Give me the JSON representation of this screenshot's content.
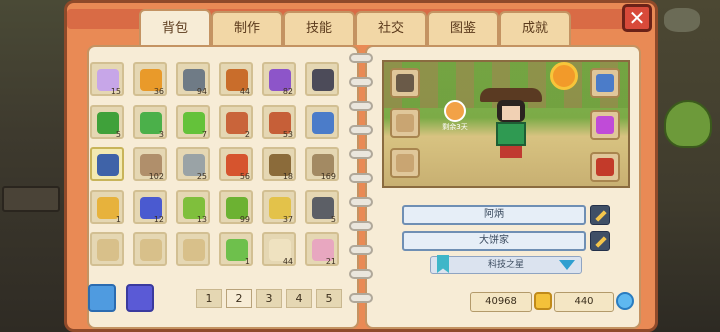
{
  "tabs": [
    {
      "label": "背包",
      "active": true
    },
    {
      "label": "制作",
      "active": false
    },
    {
      "label": "技能",
      "active": false
    },
    {
      "label": "社交",
      "active": false
    },
    {
      "label": "图鉴",
      "active": false
    },
    {
      "label": "成就",
      "active": false
    }
  ],
  "close_label": "✕",
  "inventory": {
    "slots": [
      {
        "icon": "purple-flower-seed-icon",
        "color": "#c7a6e8",
        "count": "15"
      },
      {
        "icon": "amber-leaf-icon",
        "color": "#e99a2a",
        "count": "36"
      },
      {
        "icon": "iron-ore-icon",
        "color": "#6f7b86",
        "count": "94"
      },
      {
        "icon": "copper-ore-icon",
        "color": "#c96d2b",
        "count": "44"
      },
      {
        "icon": "purple-crystal-icon",
        "color": "#8d55c9",
        "count": "82"
      },
      {
        "icon": "frying-pan-icon",
        "color": "#4c4b59",
        "count": ""
      },
      {
        "icon": "hedge-bush-icon",
        "color": "#3fa13a",
        "count": "5"
      },
      {
        "icon": "leafy-bush-icon",
        "color": "#4bb04a",
        "count": "3"
      },
      {
        "icon": "green-block-icon",
        "color": "#64c23a",
        "count": "7"
      },
      {
        "icon": "wood-log-icon",
        "color": "#c9643a",
        "count": "2"
      },
      {
        "icon": "wood-plank-icon",
        "color": "#c65f38",
        "count": "53"
      },
      {
        "icon": "wand-icon",
        "color": "#4b7cc9",
        "count": ""
      },
      {
        "icon": "blue-wand-icon",
        "color": "#3f63a8",
        "count": ""
      },
      {
        "icon": "dirt-clump-icon",
        "color": "#b08f6b",
        "count": "102"
      },
      {
        "icon": "stone-tile-icon",
        "color": "#9aa3a6",
        "count": "25"
      },
      {
        "icon": "brick-stack-icon",
        "color": "#d6542e",
        "count": "56"
      },
      {
        "icon": "stick-icon",
        "color": "#8b6b3a",
        "count": "18"
      },
      {
        "icon": "rock-icon",
        "color": "#a38a63",
        "count": "169"
      },
      {
        "icon": "golden-compass-icon",
        "color": "#e7b23c",
        "count": "1"
      },
      {
        "icon": "blue-gem-icon",
        "color": "#4a5ad0",
        "count": "12"
      },
      {
        "icon": "green-pear-icon",
        "color": "#7fbf3c",
        "count": "13"
      },
      {
        "icon": "green-pear-sprout-icon",
        "color": "#6cb232",
        "count": "99"
      },
      {
        "icon": "yellow-sprout-icon",
        "color": "#e3c24a",
        "count": "37"
      },
      {
        "icon": "dark-ore-icon",
        "color": "#5c5f66",
        "count": "5"
      },
      {
        "icon": "sand-tile-icon",
        "color": "#d8c08a",
        "count": ""
      },
      {
        "icon": "sand-tile-icon",
        "color": "#d8c08a",
        "count": ""
      },
      {
        "icon": "sand-tile-icon",
        "color": "#d8c08a",
        "count": ""
      },
      {
        "icon": "green-caterpillar-icon",
        "color": "#6ec04c",
        "count": "1"
      },
      {
        "icon": "white-worm-icon",
        "color": "#efe2c0",
        "count": "44"
      },
      {
        "icon": "pink-crystal-icon",
        "color": "#e8a7c0",
        "count": "21"
      }
    ]
  },
  "pagination": {
    "pages": [
      "1",
      "2",
      "3",
      "4",
      "5"
    ],
    "current": "2"
  },
  "character": {
    "timer_text": "剩余3天",
    "name": "阿炳",
    "profession": "大饼家",
    "title": "科技之星"
  },
  "equipment_left": [
    {
      "icon": "viking-helmet-icon",
      "color": "#6a5a48"
    },
    {
      "icon": "armor-vest-icon",
      "color": "#c9a572"
    },
    {
      "icon": "boots-icon",
      "color": "#c9a572"
    }
  ],
  "equipment_right": [
    {
      "icon": "wand-icon",
      "color": "#4b7cc9"
    },
    {
      "icon": "crystal-ring-icon",
      "color": "#c04bd8"
    },
    {
      "icon": "red-hat-icon",
      "color": "#c33a2a"
    }
  ],
  "currency": {
    "gold": "40968",
    "gems": "440"
  },
  "colors": {
    "frame": "#e98a55",
    "page": "#f7ecd6",
    "accent_blue": "#6f8fb4"
  }
}
